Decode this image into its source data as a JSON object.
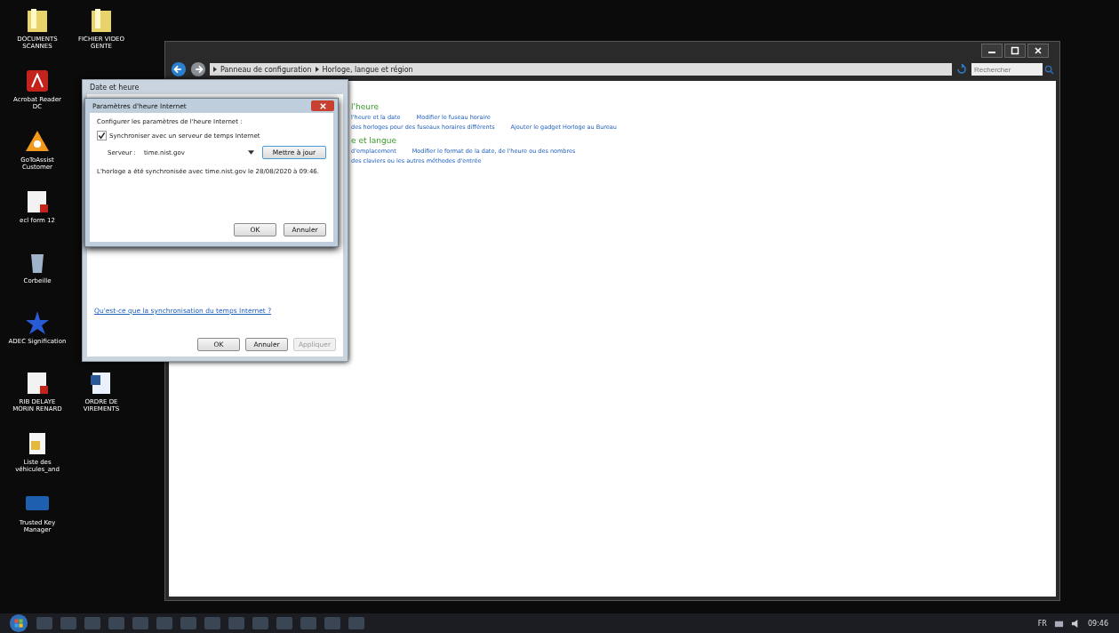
{
  "desktop_icons": [
    {
      "label": "DOCUMENTS SCANNES",
      "kind": "folder"
    },
    {
      "label": "FICHIER VIDEO GENTE",
      "kind": "folder"
    },
    {
      "label": "Acrobat Reader DC",
      "kind": "pdf"
    },
    {
      "kind": "none"
    },
    {
      "label": "GoToAssist Customer",
      "kind": "app"
    },
    {
      "kind": "none"
    },
    {
      "label": "ecl form 12",
      "kind": "pdfdoc"
    },
    {
      "kind": "none"
    },
    {
      "label": "Corbeille",
      "kind": "bin"
    },
    {
      "kind": "none"
    },
    {
      "label": "ADEC Signification",
      "kind": "star"
    },
    {
      "kind": "none"
    },
    {
      "label": "RIB DELAYE MORIN RENARD",
      "kind": "pdfdoc"
    },
    {
      "label": "ORDRE DE VIREMENTS",
      "kind": "word"
    },
    {
      "label": "Liste des véhicules_and",
      "kind": "file"
    },
    {
      "kind": "none"
    },
    {
      "label": "Trusted Key Manager",
      "kind": "key"
    }
  ],
  "control_panel": {
    "breadcrumb": [
      "Panneau de configuration",
      "Horloge, langue et région"
    ],
    "search": {
      "placeholder": "Rechercher"
    },
    "sections": [
      {
        "heading": "l'heure",
        "links": [
          [
            "l'heure et la date",
            "Modifier le fuseau horaire"
          ],
          [
            "des horloges pour des fuseaux horaires différents",
            "Ajouter le gadget Horloge au Bureau"
          ]
        ]
      },
      {
        "heading": "e et langue",
        "links": [
          [
            "d'emplacement",
            "Modifier le format de la date, de l'heure ou des nombres"
          ],
          [
            "des claviers ou les autres méthodes d'entrée"
          ]
        ]
      }
    ]
  },
  "date_time_dialog": {
    "title": "Date et heure",
    "link": "Qu'est-ce que la synchronisation du temps Internet ?",
    "buttons": [
      {
        "label": "OK",
        "disabled": false
      },
      {
        "label": "Annuler",
        "disabled": false
      },
      {
        "label": "Appliquer",
        "disabled": true
      }
    ]
  },
  "internet_time_dialog": {
    "title": "Paramètres d'heure Internet",
    "heading": "Configurer les paramètres de l'heure Internet :",
    "sync": {
      "label": "Synchroniser avec un serveur de temps Internet",
      "checked": true
    },
    "server_label": "Serveur :",
    "server_value": "time.nist.gov",
    "update_button": "Mettre à jour",
    "status": "L'horloge a été synchronisée avec time.nist.gov le 28/08/2020 à 09:46.",
    "buttons": [
      "OK",
      "Annuler"
    ]
  },
  "taskbar": {
    "language": "FR",
    "time": "09:46"
  }
}
